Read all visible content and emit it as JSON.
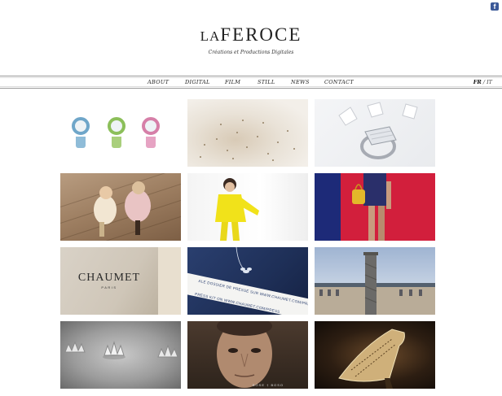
{
  "social": {
    "facebook_glyph": "f",
    "facebook_icon": "facebook-icon"
  },
  "header": {
    "logo_small": "LA",
    "logo_big": "FEROCE",
    "tagline": "Créations et Productions Digitales"
  },
  "nav": {
    "items": [
      "ABOUT",
      "DIGITAL",
      "FILM",
      "STILL",
      "NEWS",
      "CONTACT"
    ]
  },
  "lang": {
    "active": "FR",
    "separator": "/",
    "other": "IT"
  },
  "tiles": {
    "t7": {
      "brand": "CHAUMET",
      "sub": "PARIS"
    },
    "t8": {
      "line1": "ALE DOSSIER DE PRESSE SUR WWW.CHAUMET.COM/PRESS",
      "line2": "PRESS KIT ON WWW.CHAUMET.COM/PRESS"
    },
    "t11": {
      "caption": "BOSE † BOSO"
    }
  },
  "colors": {
    "accent_red": "#d21f3c",
    "accent_blue": "#1d2a78",
    "facebook": "#3b5998"
  }
}
